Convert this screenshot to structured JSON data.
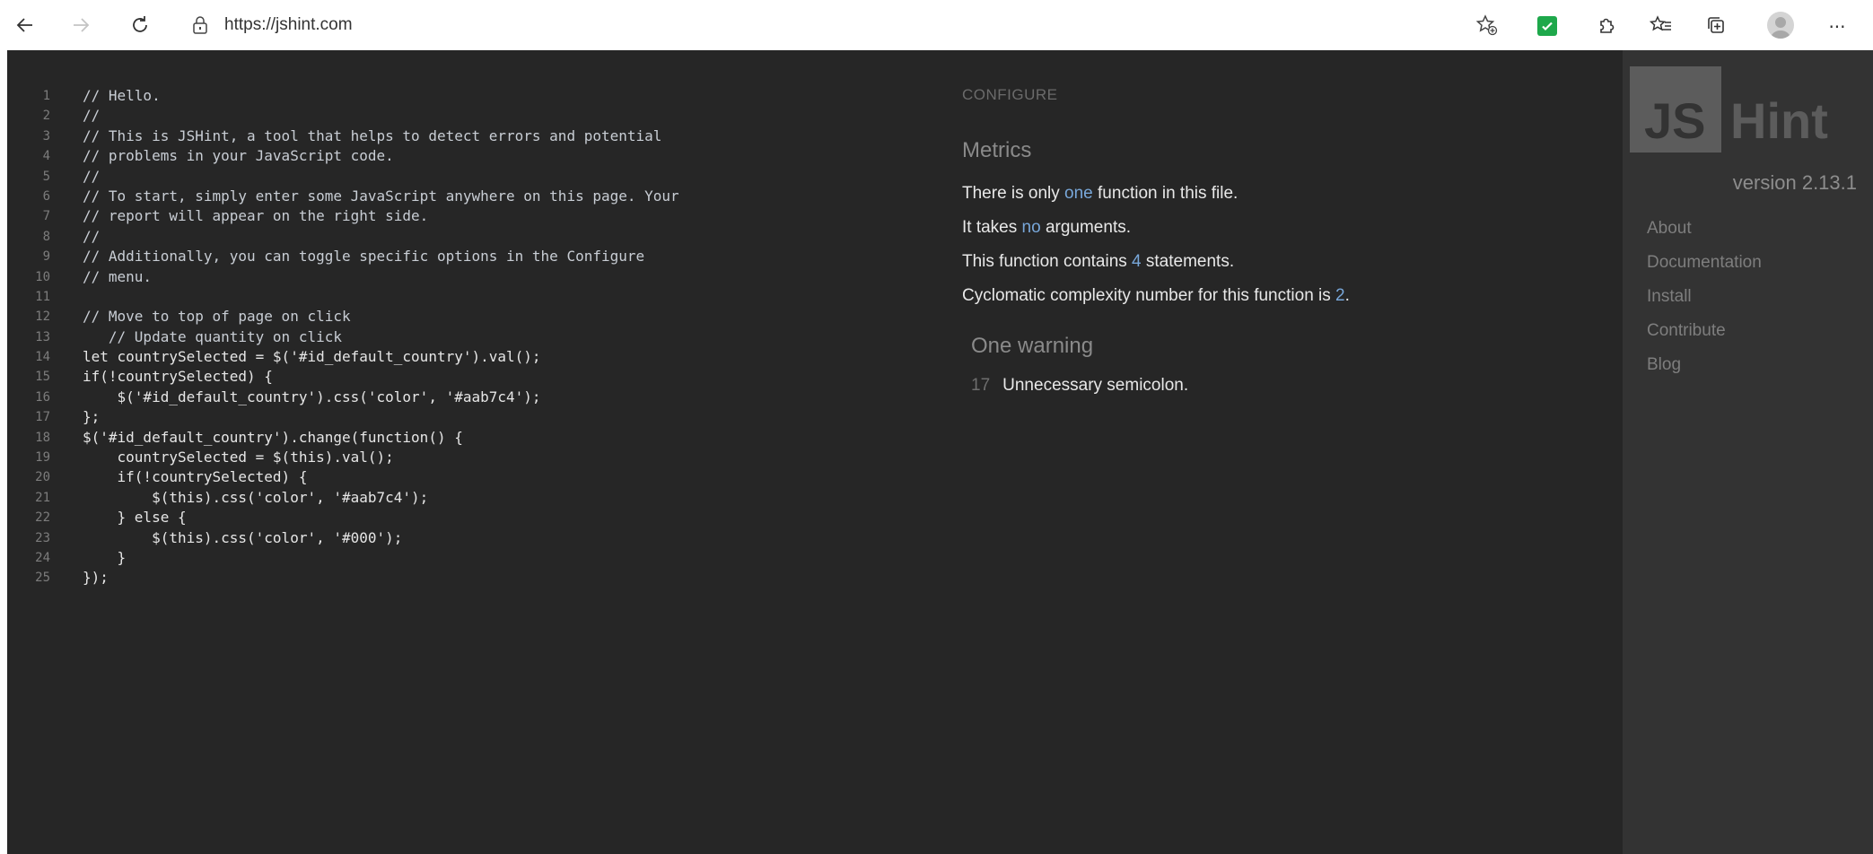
{
  "browser": {
    "url": "https://jshint.com",
    "icons": {
      "back": "back-arrow-icon",
      "forward": "forward-arrow-icon",
      "refresh": "refresh-icon",
      "lock": "lock-icon",
      "add_favorite": "add-favorite-icon",
      "extension": "checkmark-extension-icon",
      "extensions": "extensions-puzzle-icon",
      "favorites": "favorites-icon",
      "collections": "collections-icon",
      "profile": "profile-avatar-icon",
      "menu": "more-menu-icon"
    },
    "menu_glyph": "···"
  },
  "editor": {
    "lines": [
      {
        "n": "1",
        "text": "// Hello.",
        "type": "comment"
      },
      {
        "n": "2",
        "text": "//",
        "type": "comment"
      },
      {
        "n": "3",
        "text": "// This is JSHint, a tool that helps to detect errors and potential",
        "type": "comment"
      },
      {
        "n": "4",
        "text": "// problems in your JavaScript code.",
        "type": "comment"
      },
      {
        "n": "5",
        "text": "//",
        "type": "comment"
      },
      {
        "n": "6",
        "text": "// To start, simply enter some JavaScript anywhere on this page. Your",
        "type": "comment"
      },
      {
        "n": "7",
        "text": "// report will appear on the right side.",
        "type": "comment"
      },
      {
        "n": "8",
        "text": "//",
        "type": "comment"
      },
      {
        "n": "9",
        "text": "// Additionally, you can toggle specific options in the Configure",
        "type": "comment"
      },
      {
        "n": "10",
        "text": "// menu.",
        "type": "comment"
      },
      {
        "n": "11",
        "text": "",
        "type": "code"
      },
      {
        "n": "12",
        "text": "// Move to top of page on click",
        "type": "comment"
      },
      {
        "n": "13",
        "text": "   // Update quantity on click",
        "type": "comment"
      },
      {
        "n": "14",
        "text": "let countrySelected = $('#id_default_country').val();",
        "type": "code"
      },
      {
        "n": "15",
        "text": "if(!countrySelected) {",
        "type": "code"
      },
      {
        "n": "16",
        "text": "    $('#id_default_country').css('color', '#aab7c4');",
        "type": "code"
      },
      {
        "n": "17",
        "text": "};",
        "type": "code"
      },
      {
        "n": "18",
        "text": "$('#id_default_country').change(function() {",
        "type": "code"
      },
      {
        "n": "19",
        "text": "    countrySelected = $(this).val();",
        "type": "code"
      },
      {
        "n": "20",
        "text": "    if(!countrySelected) {",
        "type": "code"
      },
      {
        "n": "21",
        "text": "        $(this).css('color', '#aab7c4');",
        "type": "code"
      },
      {
        "n": "22",
        "text": "    } else {",
        "type": "code"
      },
      {
        "n": "23",
        "text": "        $(this).css('color', '#000');",
        "type": "code"
      },
      {
        "n": "24",
        "text": "    }",
        "type": "code"
      },
      {
        "n": "25",
        "text": "});",
        "type": "code"
      }
    ]
  },
  "report": {
    "configure_label": "CONFIGURE",
    "metrics_title": "Metrics",
    "metrics": {
      "m1_a": "There is only ",
      "m1_b": "one",
      "m1_c": " function in this file.",
      "m2_a": "It takes ",
      "m2_b": "no",
      "m2_c": " arguments.",
      "m3_a": "This function contains ",
      "m3_b": "4",
      "m3_c": " statements.",
      "m4_a": "Cyclomatic complexity number for this function is ",
      "m4_b": "2",
      "m4_c": "."
    },
    "warnings_title": "One warning",
    "warnings": [
      {
        "line": "17",
        "message": "Unnecessary semicolon."
      }
    ]
  },
  "sidebar": {
    "logo_left": "JS",
    "logo_right": "Hint",
    "version": "version 2.13.1",
    "nav": [
      "About",
      "Documentation",
      "Install",
      "Contribute",
      "Blog"
    ]
  },
  "colors": {
    "page_bg": "#262626",
    "sidebar_bg": "#333333",
    "link_blue": "#78a7d9",
    "extension_green": "#1ea84b"
  }
}
